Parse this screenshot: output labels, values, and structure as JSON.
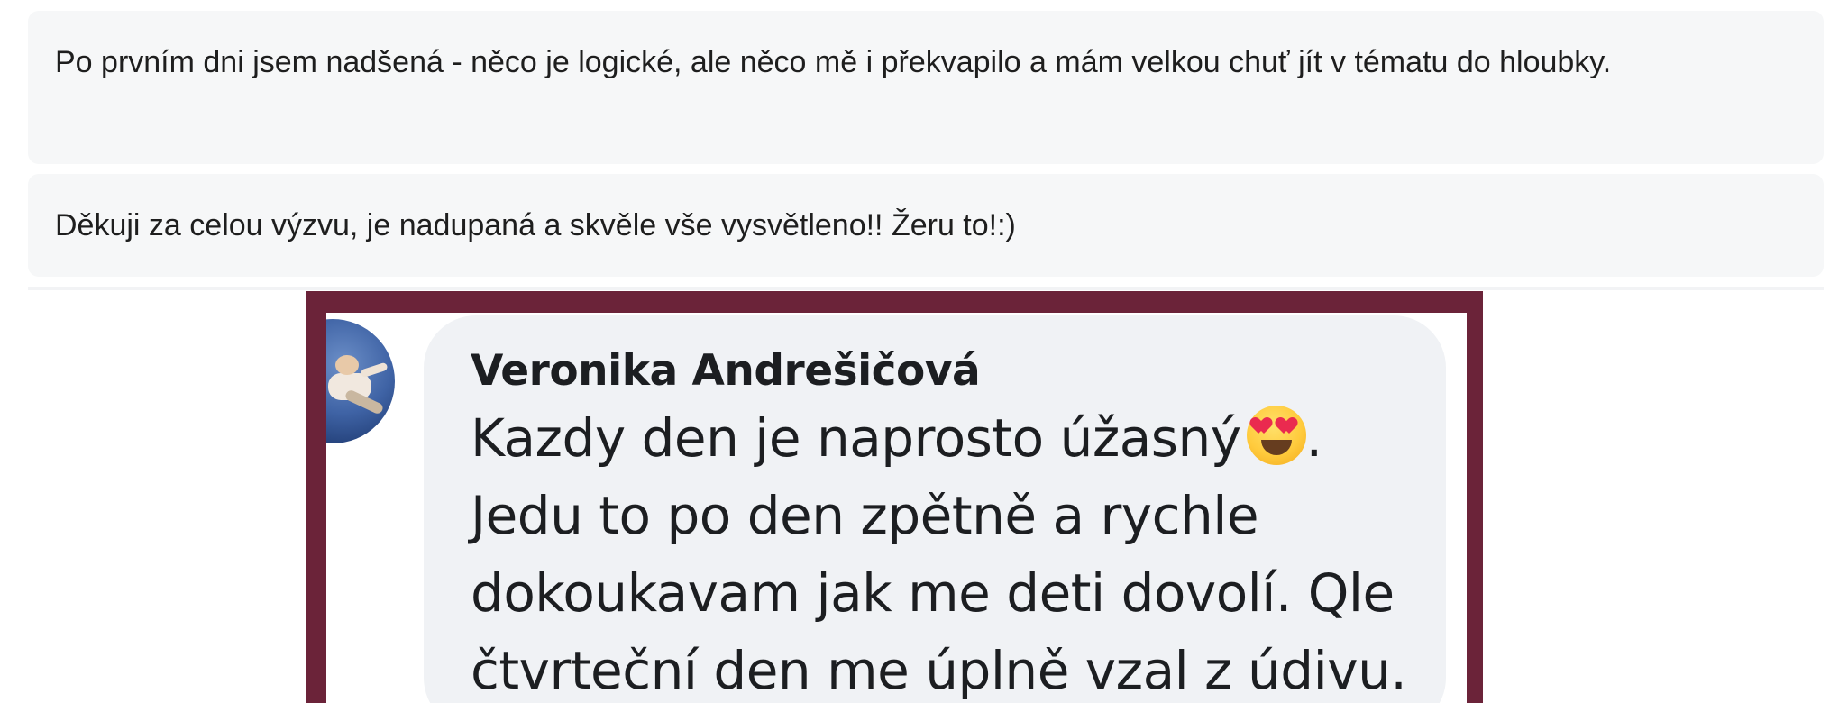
{
  "comments": [
    {
      "text": "Po prvním dni jsem nadšená - něco je logické, ale něco mě i překvapilo a mám velkou chuť jít v tématu do hloubky."
    },
    {
      "text": "Děkuji za celou výzvu, je nadupaná a skvěle vše vysvětleno!! Žeru to!:)"
    }
  ],
  "screenshot": {
    "frame_color": "#6b2339",
    "author": "Veronika Andrešičová",
    "lines": [
      "Kazdy den je naprosto úžasný",
      ".",
      "Jedu to po den zpětně a rychle",
      "dokoukavam jak me deti dovolí. Qle",
      "čtvrteční den me úplně vzal z údivu."
    ],
    "emoji": "smiling-face-with-heart-eyes-icon",
    "avatar": "user-photo"
  }
}
